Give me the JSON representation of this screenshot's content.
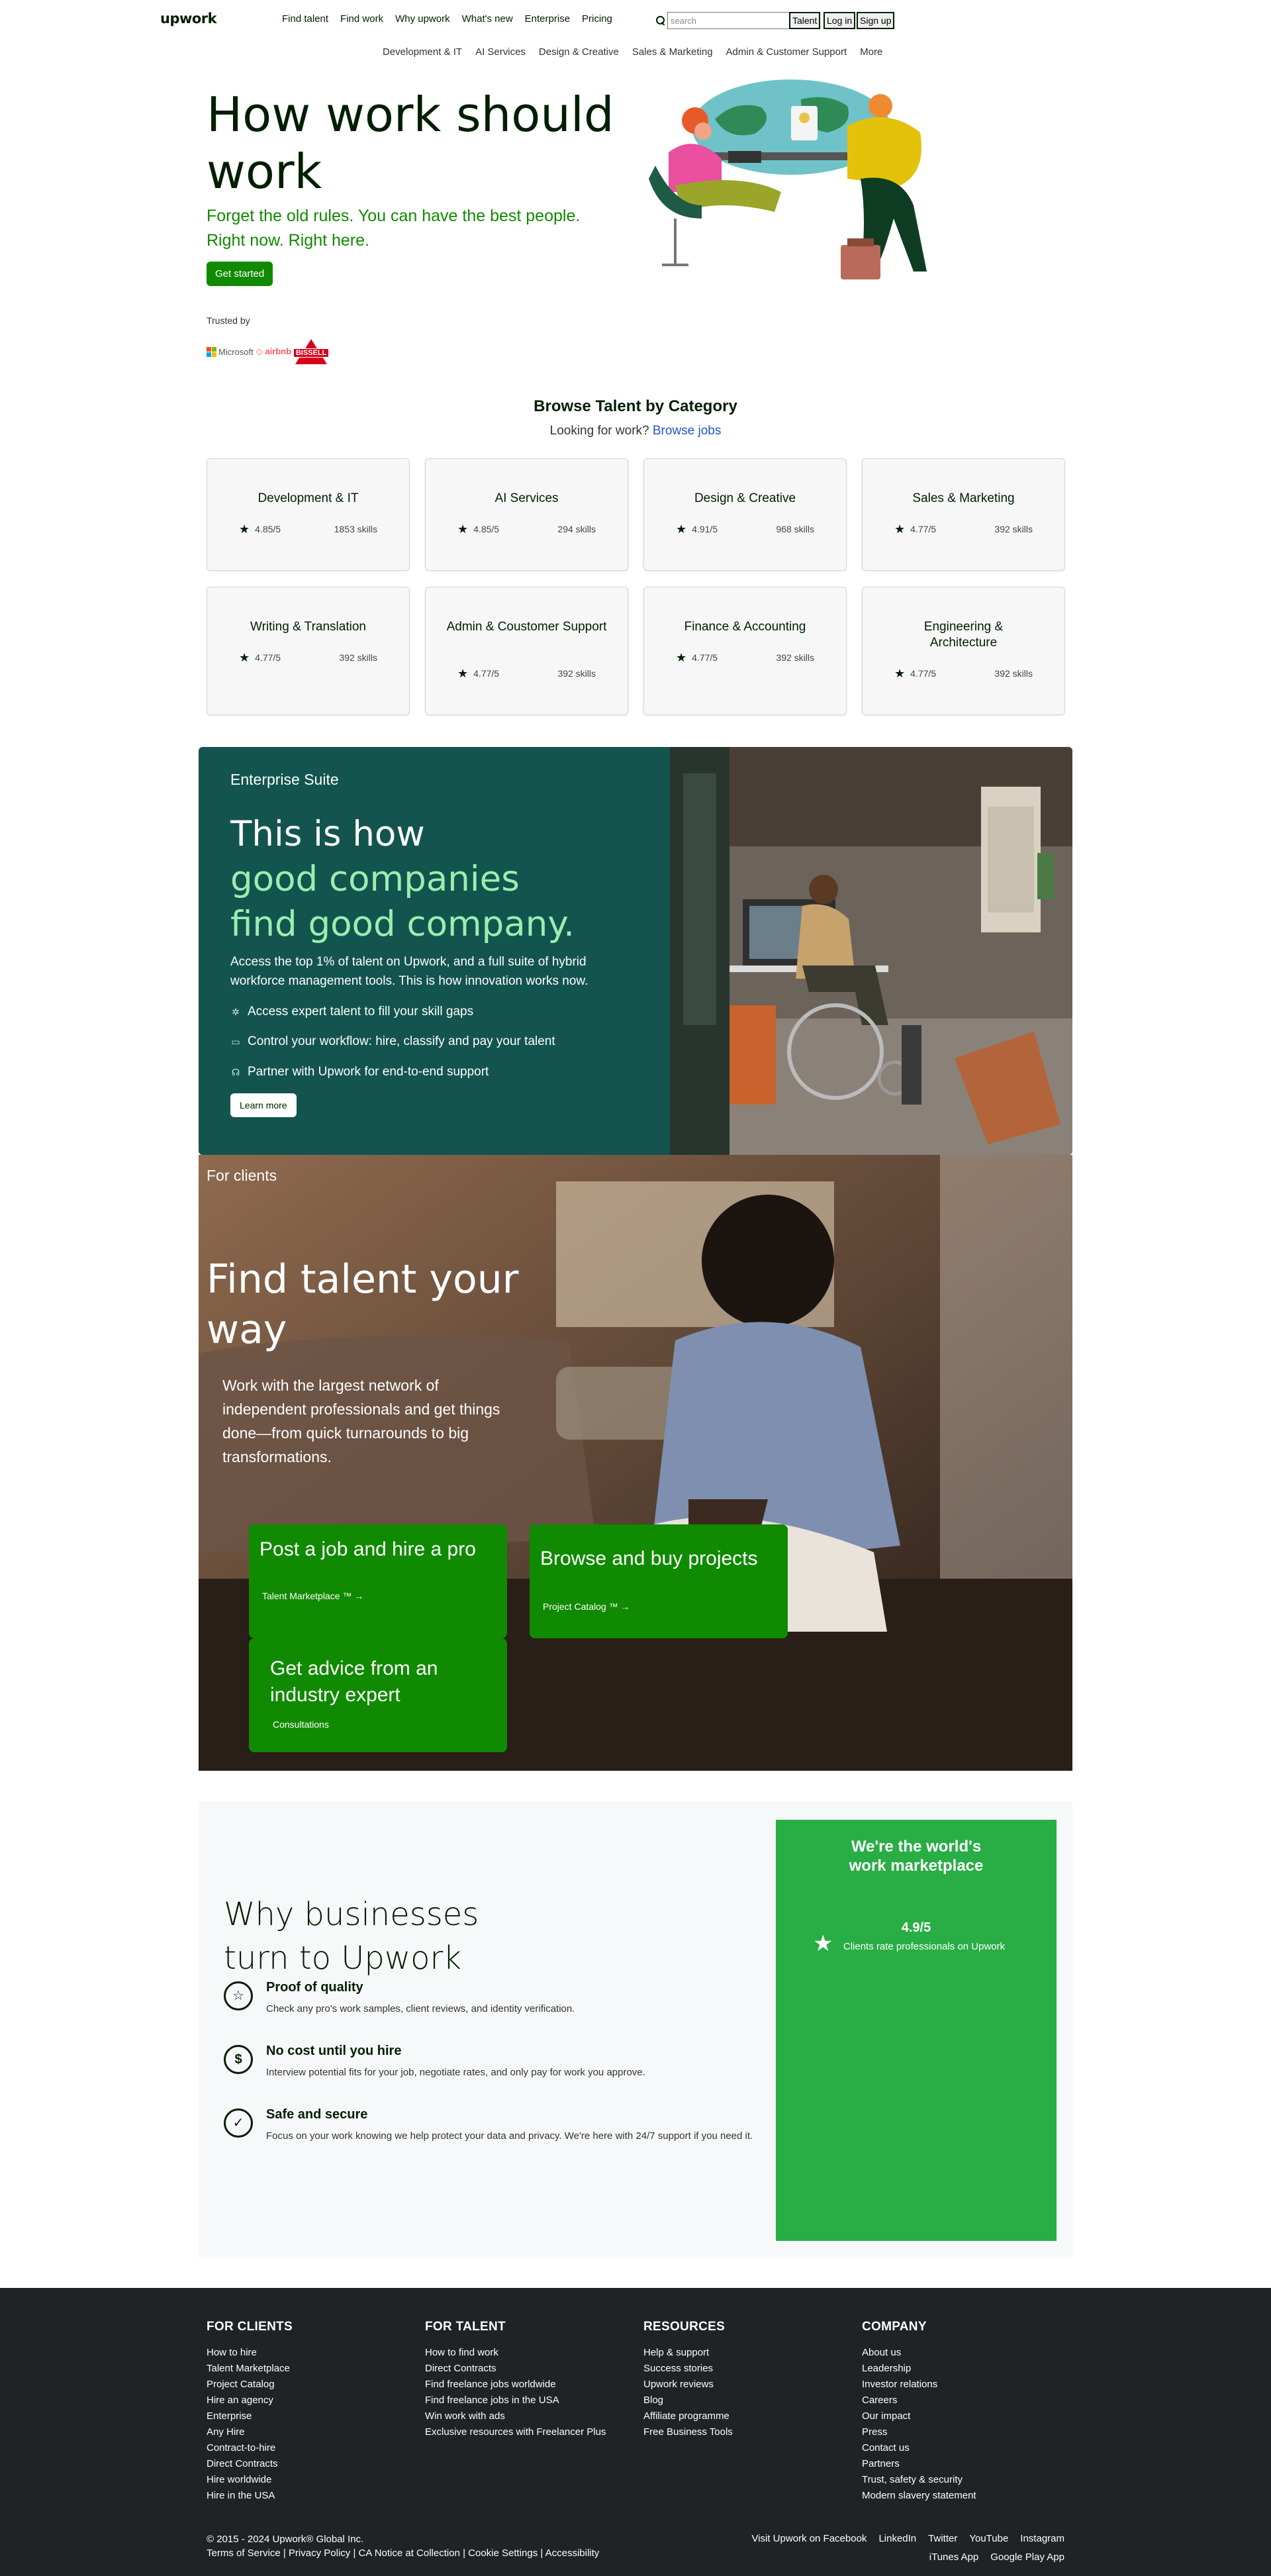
{
  "header": {
    "logo": "upwork",
    "nav": [
      "Find talent",
      "Find work",
      "Why upwork",
      "What's new",
      "Enterprise",
      "Pricing"
    ],
    "search_placeholder": "search",
    "buttons": {
      "talent": "Talent",
      "login": "Log in",
      "signup": "Sign up"
    }
  },
  "category_nav": [
    "Development & IT",
    "AI Services",
    "Design & Creative",
    "Sales & Marketing",
    "Admin & Customer Support",
    "More"
  ],
  "hero": {
    "title": "How work should work",
    "subtitle": "Forget the old rules. You can have the best people. Right now. Right here.",
    "cta": "Get started",
    "trusted_by": "Trusted by",
    "logos": {
      "microsoft": "Microsoft",
      "airbnb": "airbnb",
      "bissell": "BISSELL"
    }
  },
  "browse": {
    "title": "Browse Talent by Category",
    "sub_text": "Looking for work?",
    "sub_link": "Browse jobs",
    "categories": [
      {
        "name": "Development & IT",
        "rating": "4.85/5",
        "skills": "1853 skills"
      },
      {
        "name": "AI Services",
        "rating": "4.85/5",
        "skills": "294 skills"
      },
      {
        "name": "Design & Creative",
        "rating": "4.91/5",
        "skills": "968 skills"
      },
      {
        "name": "Sales & Marketing",
        "rating": "4.77/5",
        "skills": "392 skills"
      },
      {
        "name": "Writing & Translation",
        "rating": "4.77/5",
        "skills": "392 skills"
      },
      {
        "name": "Admin & Coustomer Support",
        "rating": "4.77/5",
        "skills": "392 skills"
      },
      {
        "name": "Finance & Accounting",
        "rating": "4.77/5",
        "skills": "392 skills"
      },
      {
        "name": "Engineering & Architecture",
        "rating": "4.77/5",
        "skills": "392 skills"
      }
    ]
  },
  "enterprise": {
    "label": "Enterprise Suite",
    "heading_line1": "This is how",
    "heading_line2": "good companies",
    "heading_line3": "find good company.",
    "description": "Access the top 1% of talent on Upwork, and a full suite of hybrid workforce management tools. This is how innovation works now.",
    "features": [
      "Access expert talent to fill your skill gaps",
      "Control your workflow: hire, classify and pay your talent",
      "Partner with Upwork for end-to-end support"
    ],
    "button": "Learn more"
  },
  "clients": {
    "label": "For clients",
    "heading": "Find talent your way",
    "description": "Work with the largest network of independent professionals and get things done—from quick turnarounds to big transformations.",
    "cards": [
      {
        "title": "Post a job and hire a pro",
        "sub": "Talent Marketplace ™ →"
      },
      {
        "title": "Browse and buy projects",
        "sub": "Project Catalog ™ →"
      },
      {
        "title": "Get advice from an industry expert",
        "sub": "Consultations"
      }
    ]
  },
  "why": {
    "heading": "Why businesses turn to Upwork",
    "items": [
      {
        "title": "Proof of quality",
        "desc": "Check any pro's work samples, client reviews, and identity verification."
      },
      {
        "title": "No cost until you hire",
        "desc": "Interview potential fits for your job, negotiate rates, and only pay for work you approve."
      },
      {
        "title": "Safe and secure",
        "desc": "Focus on your work knowing we help protect your data and privacy. We're here with 24/7 support if you need it."
      }
    ],
    "card": {
      "heading": "We're the world's work marketplace",
      "rating": "4.9/5",
      "note": "Clients rate professionals on Upwork"
    }
  },
  "footer": {
    "columns": [
      {
        "title": "FOR CLIENTS",
        "links": [
          "How to hire",
          "Talent Marketplace",
          "Project Catalog",
          "Hire an agency",
          "Enterprise",
          "Any Hire",
          "Contract-to-hire",
          "Direct Contracts",
          "Hire worldwide",
          "Hire in the USA"
        ]
      },
      {
        "title": "FOR TALENT",
        "links": [
          "How to find work",
          "Direct Contracts",
          "Find freelance jobs worldwide",
          "Find freelance jobs in the USA",
          "Win work with ads",
          "Exclusive resources with Freelancer Plus"
        ]
      },
      {
        "title": "RESOURCES",
        "links": [
          "Help & support",
          "Success stories",
          "Upwork reviews",
          "Blog",
          "Affiliate programme",
          "Free Business Tools"
        ]
      },
      {
        "title": "COMPANY",
        "links": [
          "About us",
          "Leadership",
          "Investor relations",
          "Careers",
          "Our impact",
          "Press",
          "Contact us",
          "Partners",
          "Trust, safety & security",
          "Modern slavery statement"
        ]
      }
    ],
    "copyright": "© 2015 - 2024 Upwork® Global Inc.",
    "legal": "Terms of Service | Privacy Policy | CA Notice at Collection | Cookie Settings | Accessibility",
    "social": [
      "Visit Upwork on Facebook",
      "LinkedIn",
      "Twitter",
      "YouTube",
      "Instagram"
    ],
    "apps": [
      "iTunes App",
      "Google Play App"
    ]
  }
}
